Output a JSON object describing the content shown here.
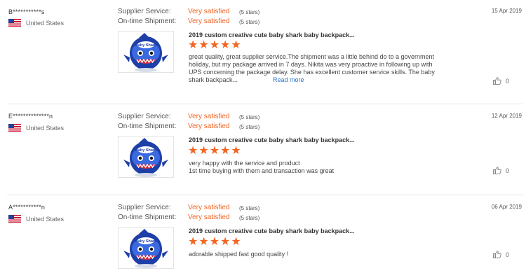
{
  "labels": {
    "supplier_service": "Supplier Service:",
    "ontime_shipment": "On-time Shipment:"
  },
  "colors": {
    "accent": "#f26522",
    "link": "#2a73c9"
  },
  "reviews": [
    {
      "buyer": "B***********s",
      "country": "United States",
      "date": "15 Apr 2019",
      "supplier_service": "Very satisfied",
      "supplier_service_stars": "(5 stars)",
      "ontime_shipment": "Very satisfied",
      "ontime_shipment_stars": "(5 stars)",
      "product_title": "2019 custom creative cute baby shark baby backpack...",
      "rating": 5,
      "text_lines": [
        "great quality, great supplier service.The shipment was a little behind do to a government",
        "holiday, but my package arrived in 7 days. Nikita was very proactive in following up with",
        "UPS concerning the package delay. She has excellent customer service skills. The baby",
        "shark backpack..."
      ],
      "read_more": "Read more",
      "likes": "0"
    },
    {
      "buyer": "E**************n",
      "country": "United States",
      "date": "12 Apr 2019",
      "supplier_service": "Very satisfied",
      "supplier_service_stars": "(5 stars)",
      "ontime_shipment": "Very satisfied",
      "ontime_shipment_stars": "(5 stars)",
      "product_title": "2019 custom creative cute baby shark baby backpack...",
      "rating": 5,
      "text_lines": [
        "very happy with the service and product",
        "1st time buying with them and transaction was great"
      ],
      "likes": "0"
    },
    {
      "buyer": "A***********n",
      "country": "United States",
      "date": "06 Apr 2019",
      "supplier_service": "Very satisfied",
      "supplier_service_stars": "(5 stars)",
      "ontime_shipment": "Very satisfied",
      "ontime_shipment_stars": "(5 stars)",
      "product_title": "2019 custom creative cute baby shark baby backpack...",
      "rating": 5,
      "text_lines": [
        "adorable shipped fast good quality !"
      ],
      "likes": "0"
    }
  ]
}
